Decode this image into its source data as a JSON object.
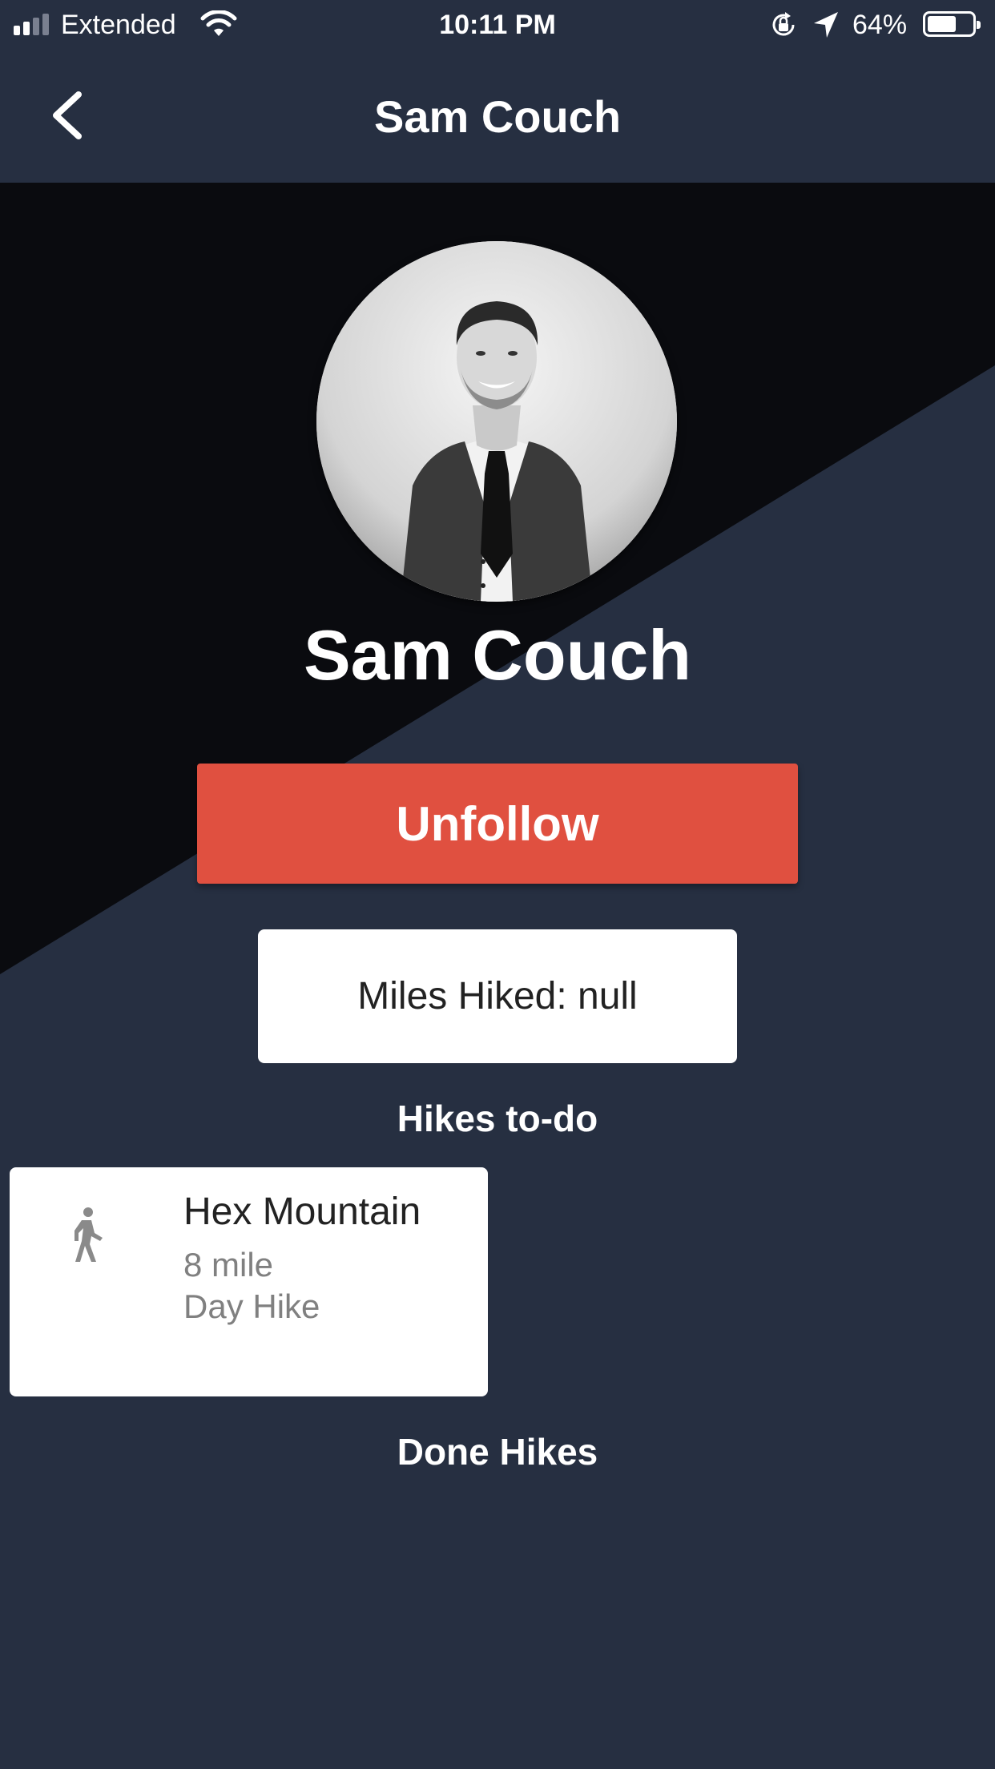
{
  "status_bar": {
    "carrier": "Extended",
    "time": "10:11 PM",
    "battery_percent": "64%",
    "battery_level": 0.64,
    "icons": [
      "signal-icon",
      "wifi-icon",
      "rotation-lock-icon",
      "location-arrow-icon",
      "battery-icon"
    ]
  },
  "nav": {
    "title": "Sam Couch",
    "back_icon": "chevron-left-icon"
  },
  "profile": {
    "name": "Sam Couch",
    "unfollow_label": "Unfollow",
    "miles_hiked": "Miles Hiked: null"
  },
  "sections": {
    "todo_title": "Hikes to-do",
    "done_title": "Done Hikes"
  },
  "hikes_todo": [
    {
      "name": "Hex Mountain",
      "distance": "8 mile",
      "type": "Day Hike",
      "icon": "hiker-icon"
    }
  ],
  "colors": {
    "background": "#262f41",
    "hero_dark": "#0a0b0f",
    "accent_red": "#e05040",
    "card": "#ffffff"
  }
}
